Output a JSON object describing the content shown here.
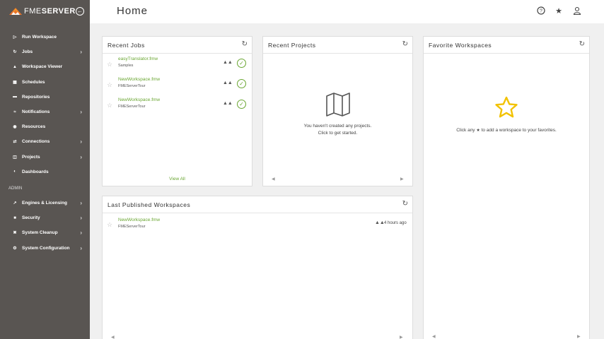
{
  "app": {
    "logo_text_light": "FME",
    "logo_text_bold": "SERVER"
  },
  "sidebar": {
    "items": [
      {
        "label": "Run Workspace",
        "icon": "run-icon",
        "chevron": false
      },
      {
        "label": "Jobs",
        "icon": "jobs-icon",
        "chevron": true
      },
      {
        "label": "Workspace Viewer",
        "icon": "workspace-viewer-icon",
        "chevron": false
      },
      {
        "label": "Schedules",
        "icon": "calendar-icon",
        "chevron": false
      },
      {
        "label": "Repositories",
        "icon": "folder-icon",
        "chevron": false
      },
      {
        "label": "Notifications",
        "icon": "notifications-icon",
        "chevron": true
      },
      {
        "label": "Resources",
        "icon": "resources-icon",
        "chevron": false
      },
      {
        "label": "Connections",
        "icon": "connections-icon",
        "chevron": true
      },
      {
        "label": "Projects",
        "icon": "projects-icon",
        "chevron": true
      },
      {
        "label": "Dashboards",
        "icon": "dashboards-icon",
        "chevron": false
      }
    ],
    "admin_label": "ADMIN",
    "admin_items": [
      {
        "label": "Engines & Licensing",
        "icon": "engines-icon",
        "chevron": true
      },
      {
        "label": "Security",
        "icon": "shield-icon",
        "chevron": true
      },
      {
        "label": "System Cleanup",
        "icon": "cleanup-icon",
        "chevron": true
      },
      {
        "label": "System Configuration",
        "icon": "gear-icon",
        "chevron": true
      }
    ]
  },
  "header": {
    "title": "Home"
  },
  "recent_jobs": {
    "title": "Recent Jobs",
    "rows": [
      {
        "name": "easyTranslator.fmw",
        "repo": "Samples"
      },
      {
        "name": "NewWorkspace.fmw",
        "repo": "FMEServerTour"
      },
      {
        "name": "NewWorkspace.fmw",
        "repo": "FMEServerTour"
      }
    ],
    "view_all": "View All"
  },
  "recent_projects": {
    "title": "Recent Projects",
    "empty_line1": "You haven't created any projects.",
    "empty_line2": "Click to get started."
  },
  "favorite_workspaces": {
    "title": "Favorite Workspaces",
    "empty_before": "Click any",
    "empty_after": "to add a workspace to your favorites."
  },
  "last_published": {
    "title": "Last Published Workspaces",
    "rows": [
      {
        "name": "NewWorkspace.fmw",
        "repo": "FMEServerTour",
        "time": "4 hours ago"
      }
    ]
  },
  "colors": {
    "sidebar": "#595552",
    "accent_green": "#6aa632",
    "star_yellow": "#f2c200"
  }
}
